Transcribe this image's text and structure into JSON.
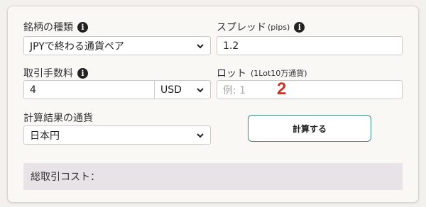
{
  "labels": {
    "brand_type": "銘柄の種類",
    "spread": "スプレッド",
    "spread_unit": "(pips)",
    "fee": "取引手数料",
    "lot": "ロット",
    "lot_unit": "(1Lot10万通貨)",
    "result_currency": "計算結果の通貨"
  },
  "info_icon": "i",
  "fields": {
    "brand_type_selected": "JPYで終わる通貨ペア",
    "spread_value": "1.2",
    "fee_value": "4",
    "fee_currency_selected": "USD",
    "lot_placeholder": "例: 1",
    "result_currency_selected": "日本円"
  },
  "annotation_number": "2",
  "calc_button": "計算する",
  "result_label": "総取引コスト："
}
